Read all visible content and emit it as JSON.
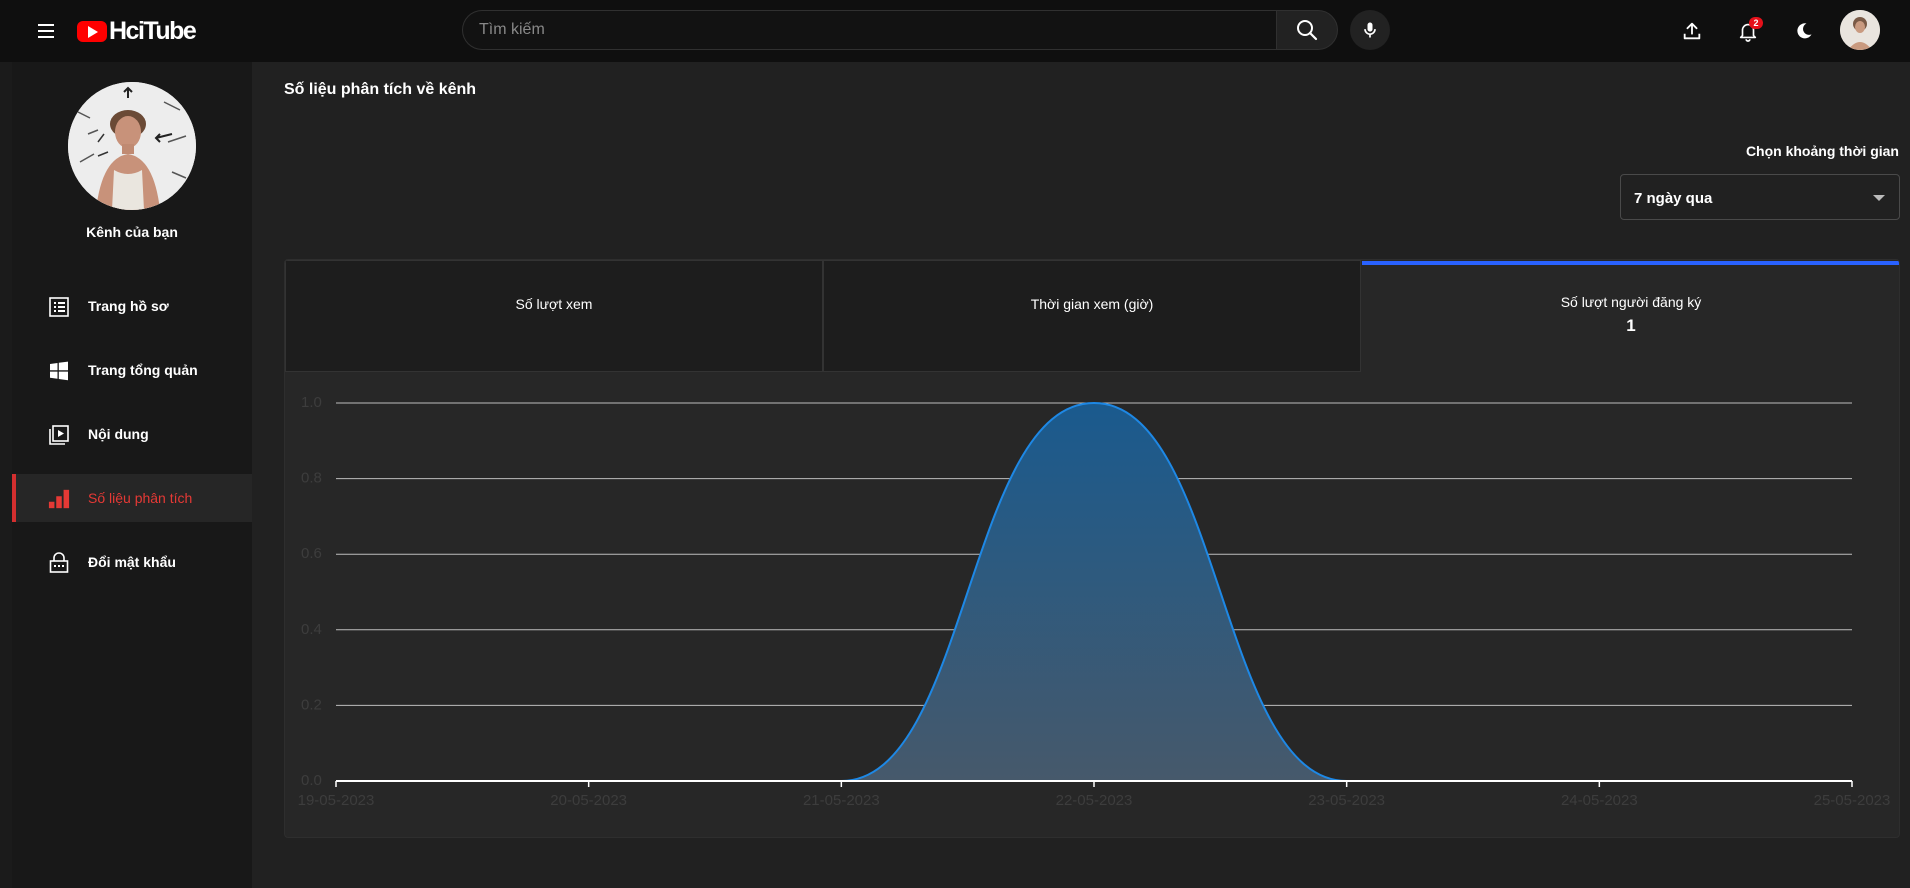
{
  "header": {
    "logo_text": "HciTube",
    "search_placeholder": "Tìm kiếm",
    "notification_count": "2"
  },
  "sidebar": {
    "channel_label": "Kênh của bạn",
    "items": [
      {
        "label": "Trang hồ sơ",
        "icon": "list-icon"
      },
      {
        "label": "Trang tổng quản",
        "icon": "windows-icon"
      },
      {
        "label": "Nội dung",
        "icon": "video-library-icon"
      },
      {
        "label": "Số liệu phân tích",
        "icon": "bar-chart-icon",
        "active": true
      },
      {
        "label": "Đổi mật khẩu",
        "icon": "lock-icon"
      }
    ]
  },
  "main": {
    "title": "Số liệu phân tích về kênh",
    "range_label": "Chọn khoảng thời gian",
    "range_value": "7 ngày qua",
    "tabs": [
      {
        "label": "Số lượt xem",
        "value": ""
      },
      {
        "label": "Thời gian xem (giờ)",
        "value": ""
      },
      {
        "label": "Số lượt người đăng ký",
        "value": "1",
        "active": true
      }
    ]
  },
  "colors": {
    "accent_active_tab": "#2962ff",
    "sidebar_active": "#e53935",
    "series_line": "#1e88e5"
  },
  "chart_data": {
    "type": "area",
    "x": [
      "19-05-2023",
      "20-05-2023",
      "21-05-2023",
      "22-05-2023",
      "23-05-2023",
      "24-05-2023",
      "25-05-2023"
    ],
    "series": [
      {
        "values": [
          0,
          0,
          0,
          1,
          0,
          0,
          0
        ]
      }
    ],
    "yticks": [
      "0.0",
      "0.2",
      "0.4",
      "0.6",
      "0.8",
      "1.0"
    ],
    "ylim": [
      0,
      1
    ],
    "grid": true,
    "smooth": true
  }
}
